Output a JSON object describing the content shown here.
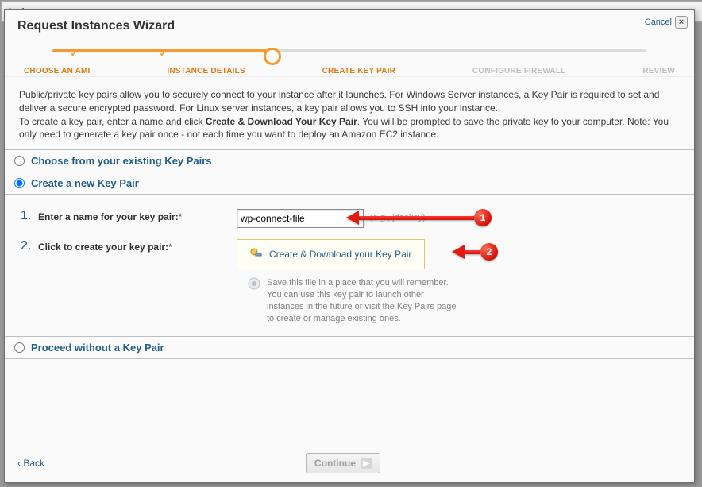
{
  "behind_menu": "Actions",
  "title": "Request Instances Wizard",
  "cancel": "Cancel",
  "steps": {
    "s1": "CHOOSE AN AMI",
    "s2": "INSTANCE DETAILS",
    "s3": "CREATE KEY PAIR",
    "s4": "CONFIGURE FIREWALL",
    "s5": "REVIEW"
  },
  "desc": {
    "p1a": "Public/private key pairs allow you to securely connect to your instance after it launches. For Windows Server instances, a Key Pair is required to set and deliver a secure encrypted password. For Linux server instances, a key pair allows you to SSH into your instance.",
    "p2a": "To create a key pair, enter a name and click ",
    "p2b": "Create & Download Your Key Pair",
    "p2c": ". You will be prompted to save the private key to your computer. Note: You only need to generate a key pair once - not each time you want to deploy an Amazon EC2 instance."
  },
  "opts": {
    "existing": "Choose from your existing Key Pairs",
    "create": "Create a new Key Pair",
    "none": "Proceed without a Key Pair"
  },
  "form": {
    "name_label": "Enter a name for your key pair:",
    "name_value": "wp-connect-file",
    "name_hint": "(e.g., jdoekey)",
    "create_label": "Click to create your key pair:",
    "dl_btn": "Create & Download your Key Pair",
    "note": "Save this file in a place that you will remember. You can use this key pair to launch other instances in the future or visit the Key Pairs page to create or manage existing ones."
  },
  "footer": {
    "back": "Back",
    "continue": "Continue"
  },
  "ann": {
    "a1": "1",
    "a2": "2"
  }
}
